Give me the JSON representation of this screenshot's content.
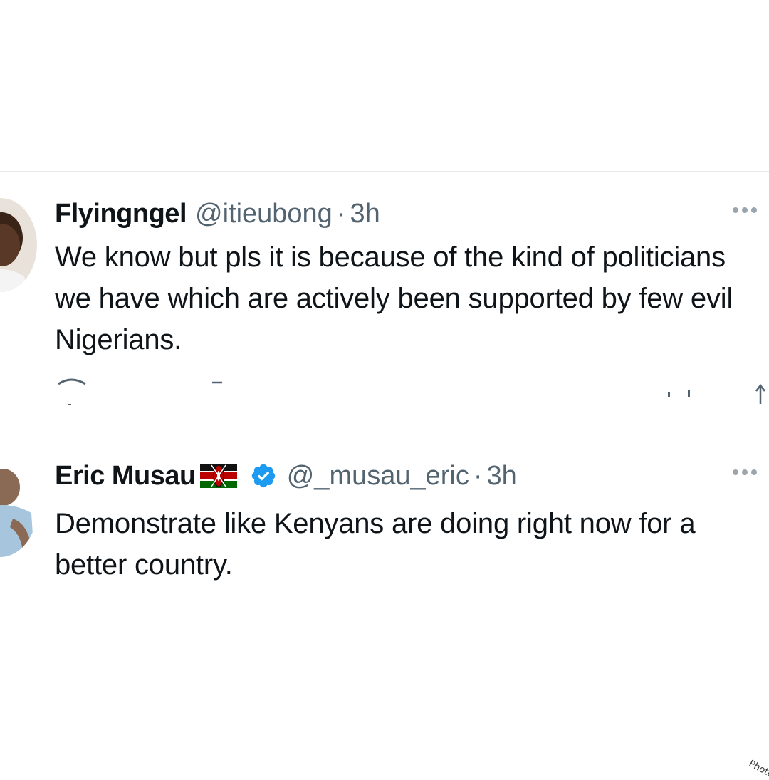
{
  "tweets": [
    {
      "display_name": "Flyingngel",
      "handle": "@itieubong",
      "separator": "·",
      "time": "3h",
      "text": "We know but pls it is because of the kind of politicians we have which are actively been supported by few evil Nigerians."
    },
    {
      "display_name": "Eric Musau",
      "flag_icon": "kenya-flag-icon",
      "verified_icon": "verified-badge-icon",
      "handle": "@_musau_eric",
      "separator": "·",
      "time": "3h",
      "text": "Demonstrate like Kenyans are doing right now for a better country."
    }
  ],
  "colors": {
    "text_primary": "#0f1419",
    "text_secondary": "#536471",
    "verified_blue": "#1d9bf0",
    "divider": "#e6e9ec"
  },
  "watermark": "Photo"
}
